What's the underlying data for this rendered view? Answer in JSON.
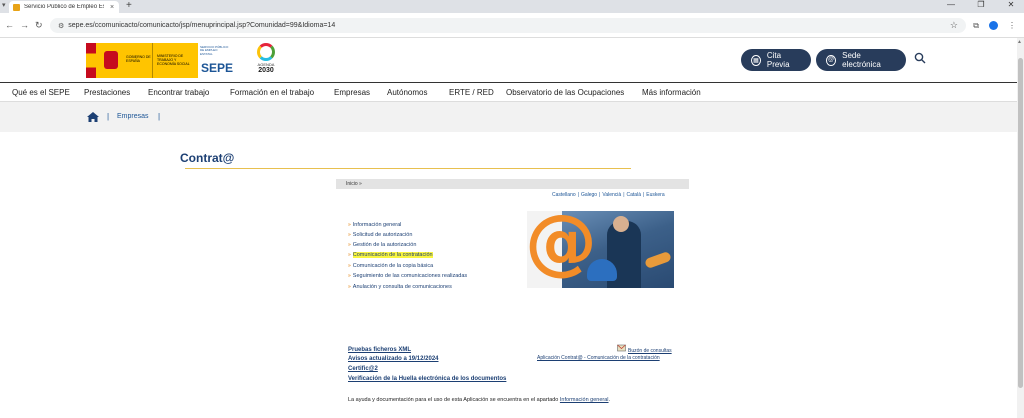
{
  "browser": {
    "tab_title": "Servicio Público de Empleo Est",
    "tab_close": "×",
    "new_tab": "+",
    "url": "sepe.es/ccomunicacto/comunicacto/jsp/menuprincipal.jsp?Comunidad=99&Idioma=14",
    "window_controls": [
      "—",
      "❐",
      "✕"
    ]
  },
  "header": {
    "logo_gobierno": "GOBIERNO DE ESPAÑA",
    "logo_ministerio": "MINISTERIO DE TRABAJO Y ECONOMÍA SOCIAL",
    "logo_sepe_small": "SERVICIO PÚBLICO DE EMPLEO ESTATAL",
    "logo_sepe": "SEPE",
    "agenda_label": "AGENDA",
    "agenda_year": "2030",
    "cita_previa": "Cita Previa",
    "sede_electronica": "Sede electrónica"
  },
  "main_nav": [
    "Qué es el SEPE",
    "Prestaciones",
    "Encontrar trabajo",
    "Formación en el trabajo",
    "Empresas",
    "Autónomos",
    "ERTE / RED",
    "Observatorio de las Ocupaciones",
    "Más información"
  ],
  "breadcrumb": {
    "separator": "|",
    "current": "Empresas"
  },
  "page": {
    "title": "Contrat@",
    "inicio": "Inicio »",
    "languages": [
      "Castellano",
      "Galego",
      "Valencià",
      "Català",
      "Euskera"
    ],
    "lang_separator": "|",
    "menu": [
      "Información general",
      "Solicitud de autorización",
      "Gestión de la autorización",
      "Comunicación de la contratación",
      "Comunicación de la copia básica",
      "Seguimiento de las comunicaciones realizadas",
      "Anulación y consulta de comunicaciones"
    ],
    "menu_bullet": "»",
    "footer_links": [
      "Pruebas ficheros XML",
      "Avisos actualizado a 19/12/2024",
      "Certific@2",
      "Verificación de la Huella electrónica de los documentos"
    ],
    "buzon": "Buzón de consultas",
    "aplicacion": "Aplicación Contrat@ - Comunicación de la contratación",
    "help_prefix": "La ayuda y documentación para el uso de esta Aplicación se encuentra en el apartado",
    "help_link": "Información general",
    "help_suffix": "."
  },
  "colors": {
    "brand_navy": "#283c5b",
    "link_blue": "#1c3f73",
    "highlight": "#f9f540",
    "bullet_orange": "#e07b00"
  }
}
